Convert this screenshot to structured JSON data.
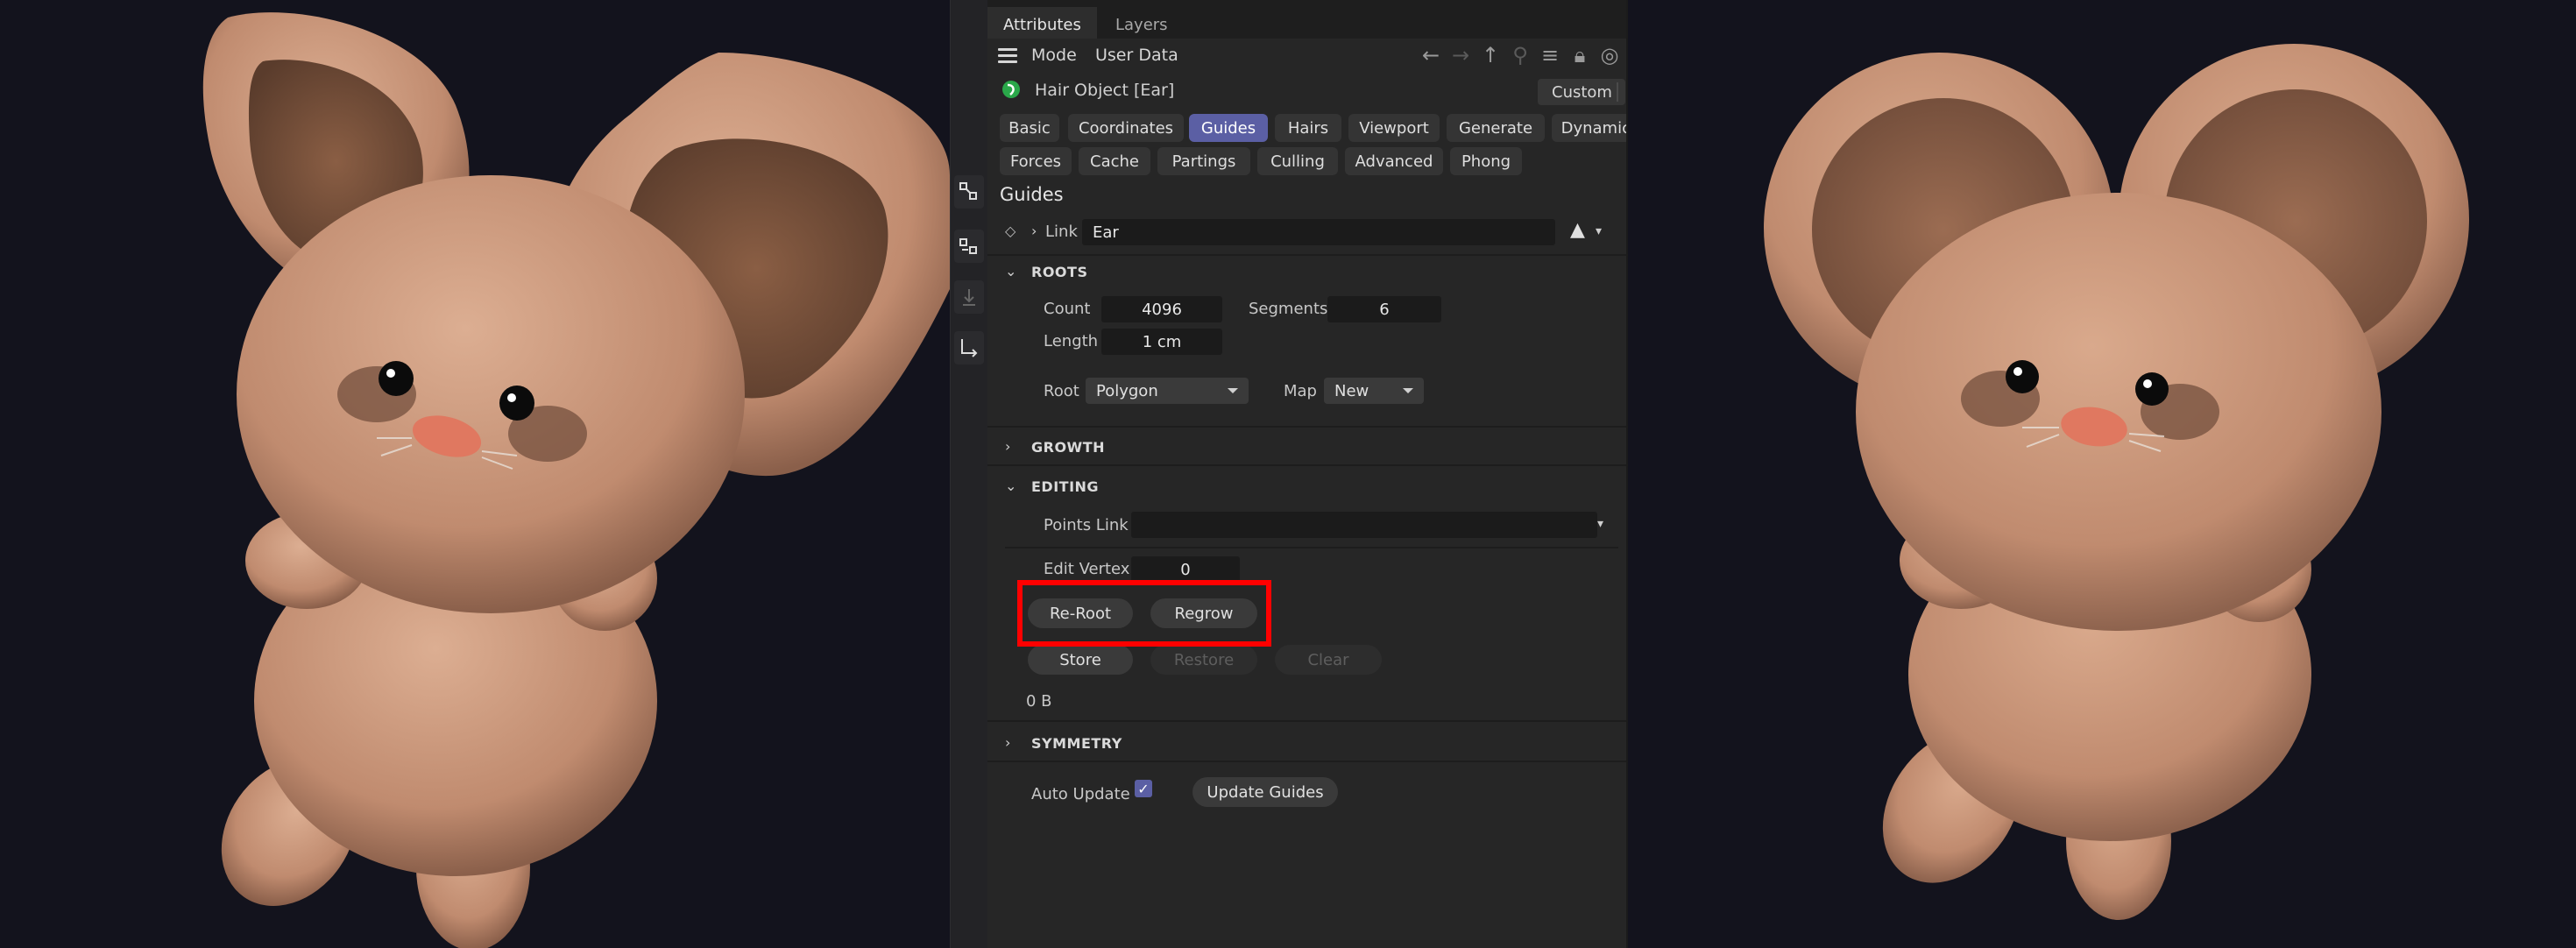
{
  "panel": {
    "tabs": [
      "Attributes",
      "Layers"
    ],
    "menu": {
      "mode": "Mode",
      "user_data": "User Data"
    },
    "nav_icons": [
      "arrow-left-icon",
      "arrow-right-icon",
      "arrow-up-icon",
      "search-icon",
      "filter-icon",
      "lock-icon",
      "target-icon"
    ],
    "object_title": "Hair Object [Ear]",
    "preset": "Custom",
    "tab_rows": [
      [
        "Basic",
        "Coordinates",
        "Guides",
        "Hairs",
        "Viewport",
        "Generate",
        "Dynamics"
      ],
      [
        "Forces",
        "Cache",
        "Partings",
        "Culling",
        "Advanced",
        "Phong"
      ]
    ],
    "active_tab": "Guides",
    "section_title": "Guides",
    "link": {
      "label": "Link",
      "value": "Ear"
    },
    "roots": {
      "title": "ROOTS",
      "count_label": "Count",
      "count": "4096",
      "segments_label": "Segments",
      "segments": "6",
      "length_label": "Length",
      "length": "1 cm",
      "root_label": "Root",
      "root": "Polygon",
      "map_label": "Map",
      "map": "New"
    },
    "growth": {
      "title": "GROWTH"
    },
    "editing": {
      "title": "EDITING",
      "points_link_label": "Points Link",
      "points_link": "",
      "edit_vertex_label": "Edit Vertex",
      "edit_vertex": "0",
      "reroot": "Re-Root",
      "regrow": "Regrow",
      "store": "Store",
      "restore": "Restore",
      "clear": "Clear",
      "memory": "0 B"
    },
    "symmetry": {
      "title": "SYMMETRY"
    },
    "auto_update_label": "Auto Update",
    "auto_update_checked": true,
    "update_guides": "Update Guides"
  },
  "colors": {
    "active_tab": "#5b5fa4",
    "highlight": "#ff0000",
    "fur": "#c8967a",
    "background": "#13131d"
  }
}
